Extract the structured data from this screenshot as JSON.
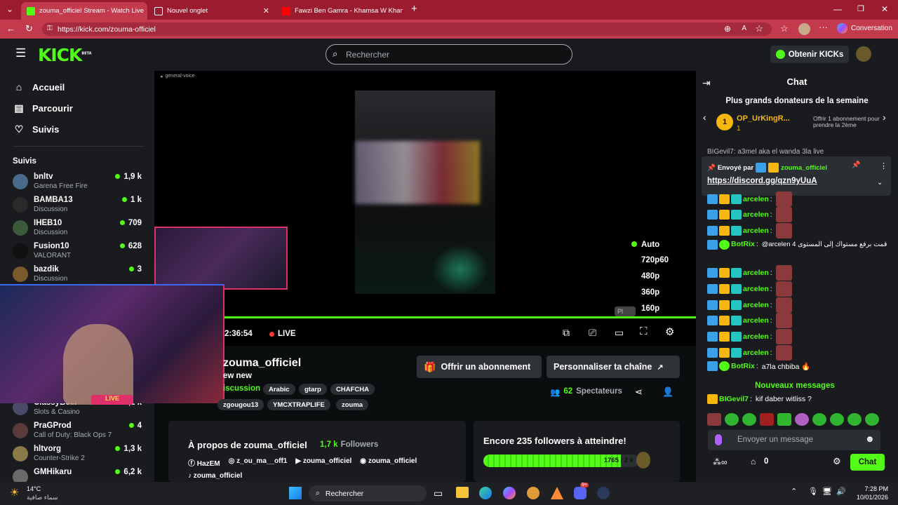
{
  "browser": {
    "tabs": [
      {
        "title": "zouma_officiel Stream - Watch Live",
        "icon": "kick-favicon"
      },
      {
        "title": "Nouvel onglet",
        "icon": "new-tab-icon"
      },
      {
        "title": "Fawzi Ben Gamra - Khamsa W Kham",
        "icon": "youtube-icon"
      }
    ],
    "url": "https://kick.com/zouma-officiel",
    "copilot_label": "Conversation"
  },
  "header": {
    "logo": "KICK",
    "logo_sup": "BETA",
    "search_placeholder": "Rechercher",
    "kicks_button": "Obtenir KICKs"
  },
  "sidebar": {
    "nav": [
      {
        "label": "Accueil",
        "icon": "home-icon"
      },
      {
        "label": "Parcourir",
        "icon": "browse-icon"
      },
      {
        "label": "Suivis",
        "icon": "heart-icon"
      }
    ],
    "following_title": "Suivis",
    "following": [
      {
        "name": "bnltv",
        "category": "Garena Free Fire",
        "viewers": "1,9 k"
      },
      {
        "name": "BAMBA13",
        "category": "Discussion",
        "viewers": "1 k"
      },
      {
        "name": "IHEB10",
        "category": "Discussion",
        "viewers": "709"
      },
      {
        "name": "Fusion10",
        "category": "VALORANT",
        "viewers": "628"
      },
      {
        "name": "bazdik",
        "category": "Discussion",
        "viewers": "3"
      },
      {
        "name": "ClassyBeef",
        "category": "Slots & Casino",
        "viewers": "2,1 k"
      },
      {
        "name": "PraGProd",
        "category": "Call of Duty: Black Ops 7",
        "viewers": "4"
      },
      {
        "name": "hltvorg",
        "category": "Counter-Strike 2",
        "viewers": "1,3 k"
      },
      {
        "name": "GMHikaru",
        "category": "",
        "viewers": "6,2 k"
      }
    ]
  },
  "player": {
    "overlay_label": "general-voice",
    "timestamp": "2:36:54",
    "live": "LIVE",
    "qualities": [
      "Auto",
      "720p60",
      "480p",
      "360p",
      "160p"
    ],
    "selected_quality": "Auto",
    "hint": "Pl"
  },
  "stream": {
    "channel": "zouma_officiel",
    "title_fragment": "ew new",
    "category": "iscussion",
    "tags": [
      "Arabic",
      "gtarp",
      "CHAFCHA",
      "zgougou13",
      "YMCXTRAPLIFE",
      "zouma"
    ],
    "subscribe_button": "Offrir un abonnement",
    "customize_button": "Personnaliser ta chaîne",
    "viewers_count": "62",
    "viewers_label": "Spectateurs",
    "cam_overlay": "LIVE"
  },
  "about": {
    "title": "À propos de zouma_officiel",
    "followers_count": "1,7 k",
    "followers_label": "Followers",
    "socials": [
      {
        "icon": "facebook-icon",
        "label": "HazEM"
      },
      {
        "icon": "instagram-icon",
        "label": "z_ou_ma__off1"
      },
      {
        "icon": "youtube-icon",
        "label": "zouma_officiel"
      },
      {
        "icon": "discord-icon",
        "label": "zouma_officiel"
      },
      {
        "icon": "tiktok-icon",
        "label": "zouma_officiel"
      }
    ]
  },
  "goal": {
    "title": "Encore 235 followers à atteindre!",
    "progress_text": "1765 / 2 k",
    "fraction": 0.8825
  },
  "chat": {
    "title": "Chat",
    "leaderboard_title": "Plus grands donateurs de la semaine",
    "top_donor": {
      "rank": "1",
      "name": "OP_UrKingR...",
      "amount": "1"
    },
    "gift_text": "Offrir 1 abonnement pour prendre la 2ème",
    "partial_line": "BIGevil7: a3mel aka el wanda 3la live",
    "pinned": {
      "label": "Envoyé par",
      "user": "zouma_officiel",
      "link": "https://discord.gg/qzn9yUuA"
    },
    "messages": [
      {
        "user": "arcelen",
        "text": ""
      },
      {
        "user": "arcelen",
        "text": ""
      },
      {
        "user": "arcelen",
        "text": ""
      },
      {
        "user": "BotRix",
        "text": "@arcelen قمت برفع مستواك إلى المستوى 4"
      },
      {
        "user": "arcelen",
        "text": ""
      },
      {
        "user": "arcelen",
        "text": ""
      },
      {
        "user": "arcelen",
        "text": ""
      },
      {
        "user": "arcelen",
        "text": ""
      },
      {
        "user": "arcelen",
        "text": ""
      },
      {
        "user": "arcelen",
        "text": ""
      },
      {
        "user": "BotRix",
        "text": "a7la chbiba 🔥"
      }
    ],
    "new_messages": "Nouveaux messages",
    "last_message": {
      "user": "BIGevil7",
      "text": "kif daber witliss ?"
    },
    "input_placeholder": "Envoyer un message",
    "points": "0",
    "send_button": "Chat"
  },
  "taskbar": {
    "weather_temp": "14°C",
    "weather_desc": "سماء صافية",
    "search": "Rechercher",
    "time": "7:28 PM",
    "date": "10/01/2026",
    "notif_count": "9+"
  }
}
